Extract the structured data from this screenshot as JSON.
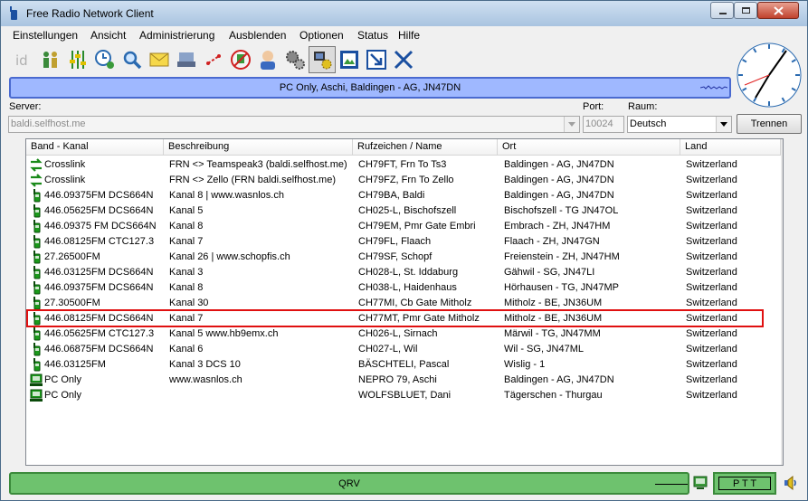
{
  "window": {
    "title": "Free Radio Network Client"
  },
  "menu": [
    "Einstellungen",
    "Ansicht",
    "Administrierung",
    "Ausblenden",
    "Optionen",
    "Status",
    "Hilfe"
  ],
  "toolbar_icons": [
    "id-icon",
    "users-icon",
    "equalizer-icon",
    "clock-user-icon",
    "magnifier-icon",
    "envelope-icon",
    "hand-icon",
    "mute-icon",
    "no-parking-icon",
    "avatar-icon",
    "gears-icon",
    "computer-gear-icon",
    "image-icon",
    "arrow-down-right-icon",
    "close-x-icon"
  ],
  "top_status": {
    "text": "PC Only, Aschi, Baldingen - AG, JN47DN"
  },
  "server": {
    "label": "Server:",
    "value": "baldi.selfhost.me"
  },
  "port": {
    "label": "Port:",
    "value": "10024"
  },
  "room": {
    "label": "Raum:",
    "value": "Deutsch"
  },
  "disconnect_label": "Trennen",
  "columns": [
    "Band - Kanal",
    "Beschreibung",
    "Rufzeichen / Name",
    "Ort",
    "Land"
  ],
  "rows": [
    {
      "icon": "crosslink",
      "band": "Crosslink",
      "desc": "FRN <> Teamspeak3 (baldi.selfhost.me)",
      "call": "CH79FT, Frn To Ts3",
      "ort": "Baldingen - AG, JN47DN",
      "land": "Switzerland"
    },
    {
      "icon": "crosslink",
      "band": "Crosslink",
      "desc": "FRN <> Zello (FRN baldi.selfhost.me)",
      "call": "CH79FZ, Frn To Zello",
      "ort": "Baldingen - AG, JN47DN",
      "land": "Switzerland"
    },
    {
      "icon": "radio",
      "band": "446.09375FM DCS664N",
      "desc": "Kanal 8 | www.wasnlos.ch",
      "call": "CH79BA, Baldi",
      "ort": "Baldingen - AG, JN47DN",
      "land": "Switzerland"
    },
    {
      "icon": "radio",
      "band": "446.05625FM DCS664N",
      "desc": "Kanal 5",
      "call": "CH025-L, Bischofszell",
      "ort": "Bischofszell - TG JN47OL",
      "land": "Switzerland"
    },
    {
      "icon": "radio",
      "band": " 446.09375 FM DCS664N",
      "desc": "Kanal 8",
      "call": "CH79EM, Pmr Gate Embri",
      "ort": "Embrach - ZH, JN47HM",
      "land": "Switzerland"
    },
    {
      "icon": "radio",
      "band": "446.08125FM CTC127.3",
      "desc": "Kanal 7",
      "call": "CH79FL, Flaach",
      "ort": "Flaach - ZH, JN47GN",
      "land": "Switzerland"
    },
    {
      "icon": "radio",
      "band": " 27.26500FM",
      "desc": "Kanal 26 | www.schopfis.ch",
      "call": "CH79SF, Schopf",
      "ort": "Freienstein - ZH, JN47HM",
      "land": "Switzerland"
    },
    {
      "icon": "radio",
      "band": "446.03125FM DCS664N",
      "desc": "Kanal 3",
      "call": "CH028-L, St. Iddaburg",
      "ort": "Gähwil - SG, JN47LI",
      "land": "Switzerland"
    },
    {
      "icon": "radio",
      "band": "446.09375FM DCS664N",
      "desc": "Kanal 8",
      "call": "CH038-L, Haidenhaus",
      "ort": "Hörhausen - TG, JN47MP",
      "land": "Switzerland"
    },
    {
      "icon": "radio",
      "band": " 27.30500FM",
      "desc": "Kanal 30",
      "call": "CH77MI, Cb Gate Mitholz",
      "ort": "Mitholz - BE, JN36UM",
      "land": "Switzerland"
    },
    {
      "icon": "radio",
      "band": "446.08125FM DCS664N",
      "desc": "Kanal 7",
      "call": "CH77MT, Pmr Gate Mitholz",
      "ort": "Mitholz - BE, JN36UM",
      "land": "Switzerland"
    },
    {
      "icon": "radio",
      "band": "446.05625FM CTC127.3",
      "desc": "Kanal 5 www.hb9emx.ch",
      "call": "CH026-L, Sirnach",
      "ort": "Märwil - TG, JN47MM",
      "land": "Switzerland"
    },
    {
      "icon": "radio",
      "band": "446.06875FM DCS664N",
      "desc": "Kanal 6",
      "call": "CH027-L, Wil",
      "ort": "Wil - SG, JN47ML",
      "land": "Switzerland"
    },
    {
      "icon": "radio",
      "band": "446.03125FM",
      "desc": "Kanal 3 DCS 10",
      "call": "BÄSCHTELI, Pascal",
      "ort": "Wislig - 1",
      "land": "Switzerland"
    },
    {
      "icon": "pc",
      "band": "PC Only",
      "desc": "www.wasnlos.ch",
      "call": "NEPRO 79, Aschi",
      "ort": "Baldingen - AG, JN47DN",
      "land": "Switzerland"
    },
    {
      "icon": "pc",
      "band": "PC Only",
      "desc": "",
      "call": "WOLFSBLUET, Dani",
      "ort": "Tägerschen - Thurgau",
      "land": "Switzerland"
    }
  ],
  "highlighted_row_index": 10,
  "bottom_status": {
    "text": "QRV"
  },
  "ptt_label": "P T T",
  "colors": {
    "top_status": "#9fb8ff",
    "bottom_status": "#6ec26e",
    "highlight": "#e01010"
  }
}
